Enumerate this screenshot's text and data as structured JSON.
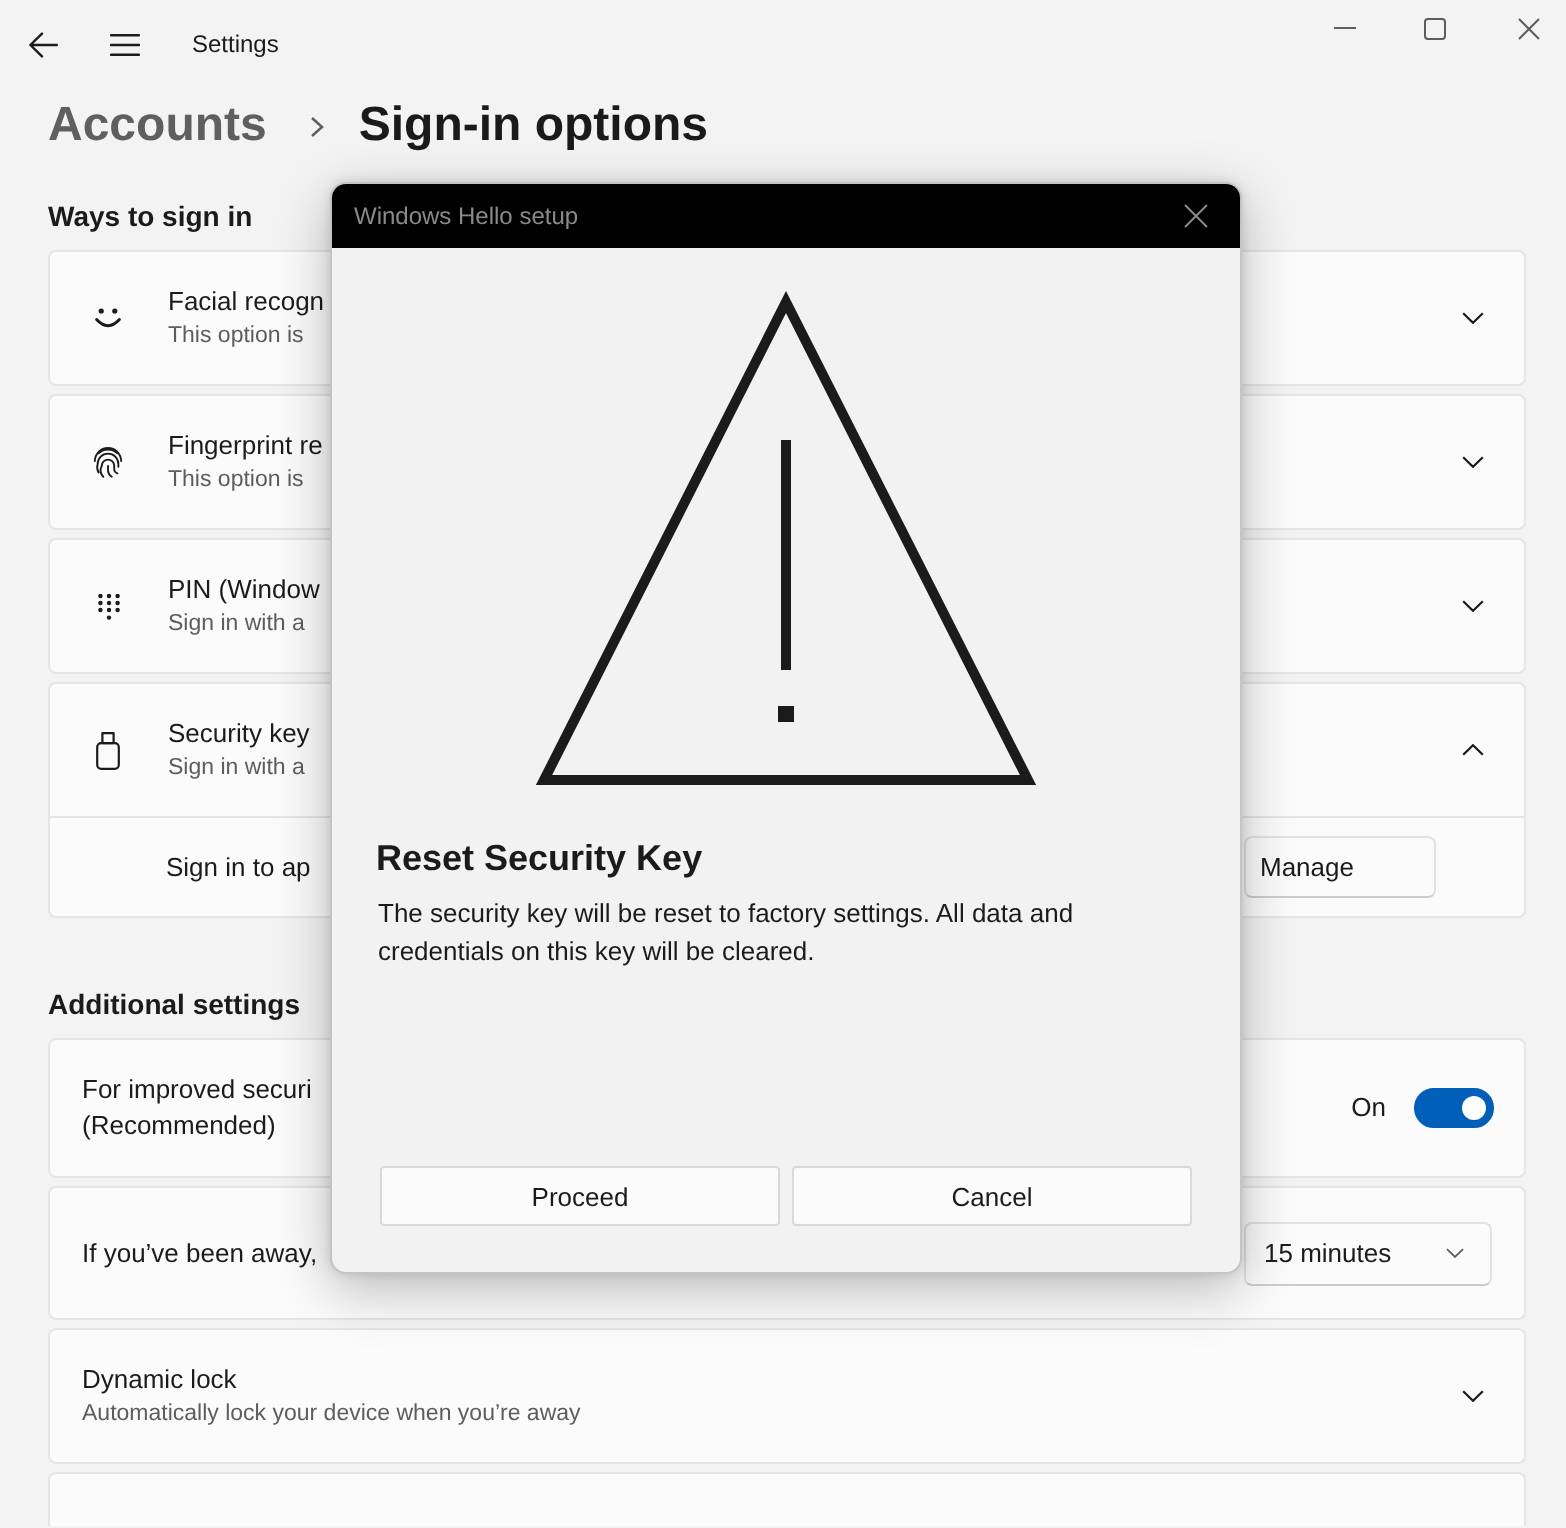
{
  "window": {
    "title": "Settings"
  },
  "breadcrumb": [
    {
      "label": "Accounts",
      "current": false
    },
    {
      "label": "Sign-in options",
      "current": true
    }
  ],
  "sections": [
    {
      "heading": "Ways to sign in",
      "items": [
        {
          "kind": "option",
          "title": "Facial recogn",
          "subtitle": "This option is",
          "expanded": false
        },
        {
          "kind": "option",
          "title": "Fingerprint re",
          "subtitle": "This option is",
          "expanded": false
        },
        {
          "kind": "option",
          "title": "PIN (Window",
          "subtitle": "Sign in with a",
          "expanded": false
        },
        {
          "kind": "option",
          "title": "Security key",
          "subtitle": "Sign in with a",
          "expanded": true,
          "children": [
            {
              "kind": "action",
              "label": "Sign in to ap",
              "button": "Manage"
            }
          ]
        }
      ]
    },
    {
      "heading": "Additional settings",
      "items": [
        {
          "kind": "toggle",
          "title": "For improved securi",
          "note": "(Recommended)",
          "state_label": "On",
          "on": true
        },
        {
          "kind": "dropdown",
          "title": "If you’ve been away,",
          "value": "15 minutes"
        },
        {
          "kind": "option",
          "title": "Dynamic lock",
          "subtitle": "Automatically lock your device when you’re away",
          "expanded": false
        },
        {
          "kind": "blank"
        }
      ]
    }
  ],
  "dialog": {
    "title": "Windows Hello setup",
    "heading": "Reset Security Key",
    "message": "The security key will be reset to factory settings. All data and credentials on this key will be cleared.",
    "buttons": [
      "Proceed",
      "Cancel"
    ]
  }
}
